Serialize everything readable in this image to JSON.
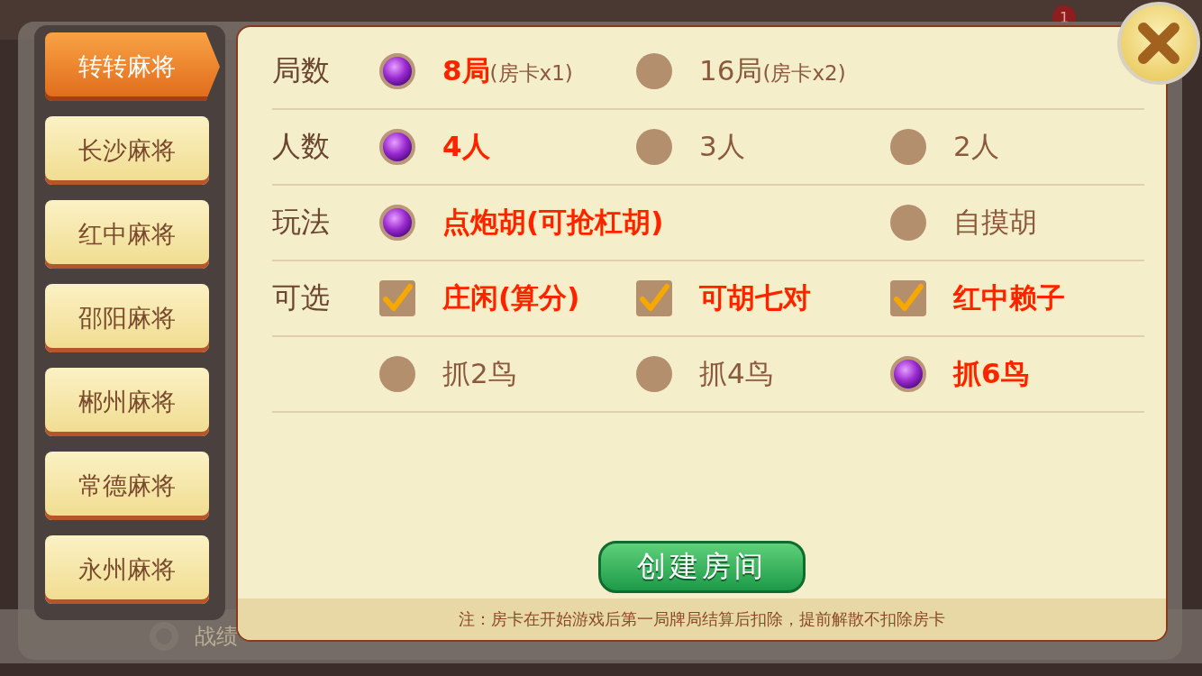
{
  "lobby": {
    "badge": "1",
    "bottom_label": "战绩"
  },
  "sidebar": {
    "items": [
      {
        "label": "转转麻将",
        "selected": true
      },
      {
        "label": "长沙麻将",
        "selected": false
      },
      {
        "label": "红中麻将",
        "selected": false
      },
      {
        "label": "邵阳麻将",
        "selected": false
      },
      {
        "label": "郴州麻将",
        "selected": false
      },
      {
        "label": "常德麻将",
        "selected": false
      },
      {
        "label": "永州麻将",
        "selected": false
      }
    ]
  },
  "options": [
    {
      "label": "局数",
      "kind": "radio",
      "choices": [
        {
          "text": "8局",
          "note": "(房卡x1)",
          "selected": true
        },
        {
          "text": "16局",
          "note": "(房卡x2)",
          "selected": false
        }
      ]
    },
    {
      "label": "人数",
      "kind": "radio",
      "choices": [
        {
          "text": "4人",
          "selected": true
        },
        {
          "text": "3人",
          "selected": false
        },
        {
          "text": "2人",
          "selected": false
        }
      ]
    },
    {
      "label": "玩法",
      "kind": "radio",
      "choices": [
        {
          "text": "点炮胡(可抢杠胡)",
          "selected": true
        },
        {
          "text": "自摸胡",
          "selected": false
        }
      ]
    },
    {
      "label": "可选",
      "kind": "checkbox",
      "choices": [
        {
          "text": "庄闲(算分)",
          "checked": true
        },
        {
          "text": "可胡七对",
          "checked": true
        },
        {
          "text": "红中赖子",
          "checked": true
        }
      ]
    },
    {
      "kind": "radio",
      "choices": [
        {
          "text": "抓2鸟",
          "selected": false
        },
        {
          "text": "抓4鸟",
          "selected": false
        },
        {
          "text": "抓6鸟",
          "selected": true
        }
      ]
    }
  ],
  "create_button": "创建房间",
  "footer_note": "注：房卡在开始游戏后第一局牌局结算后扣除，提前解散不扣除房卡"
}
